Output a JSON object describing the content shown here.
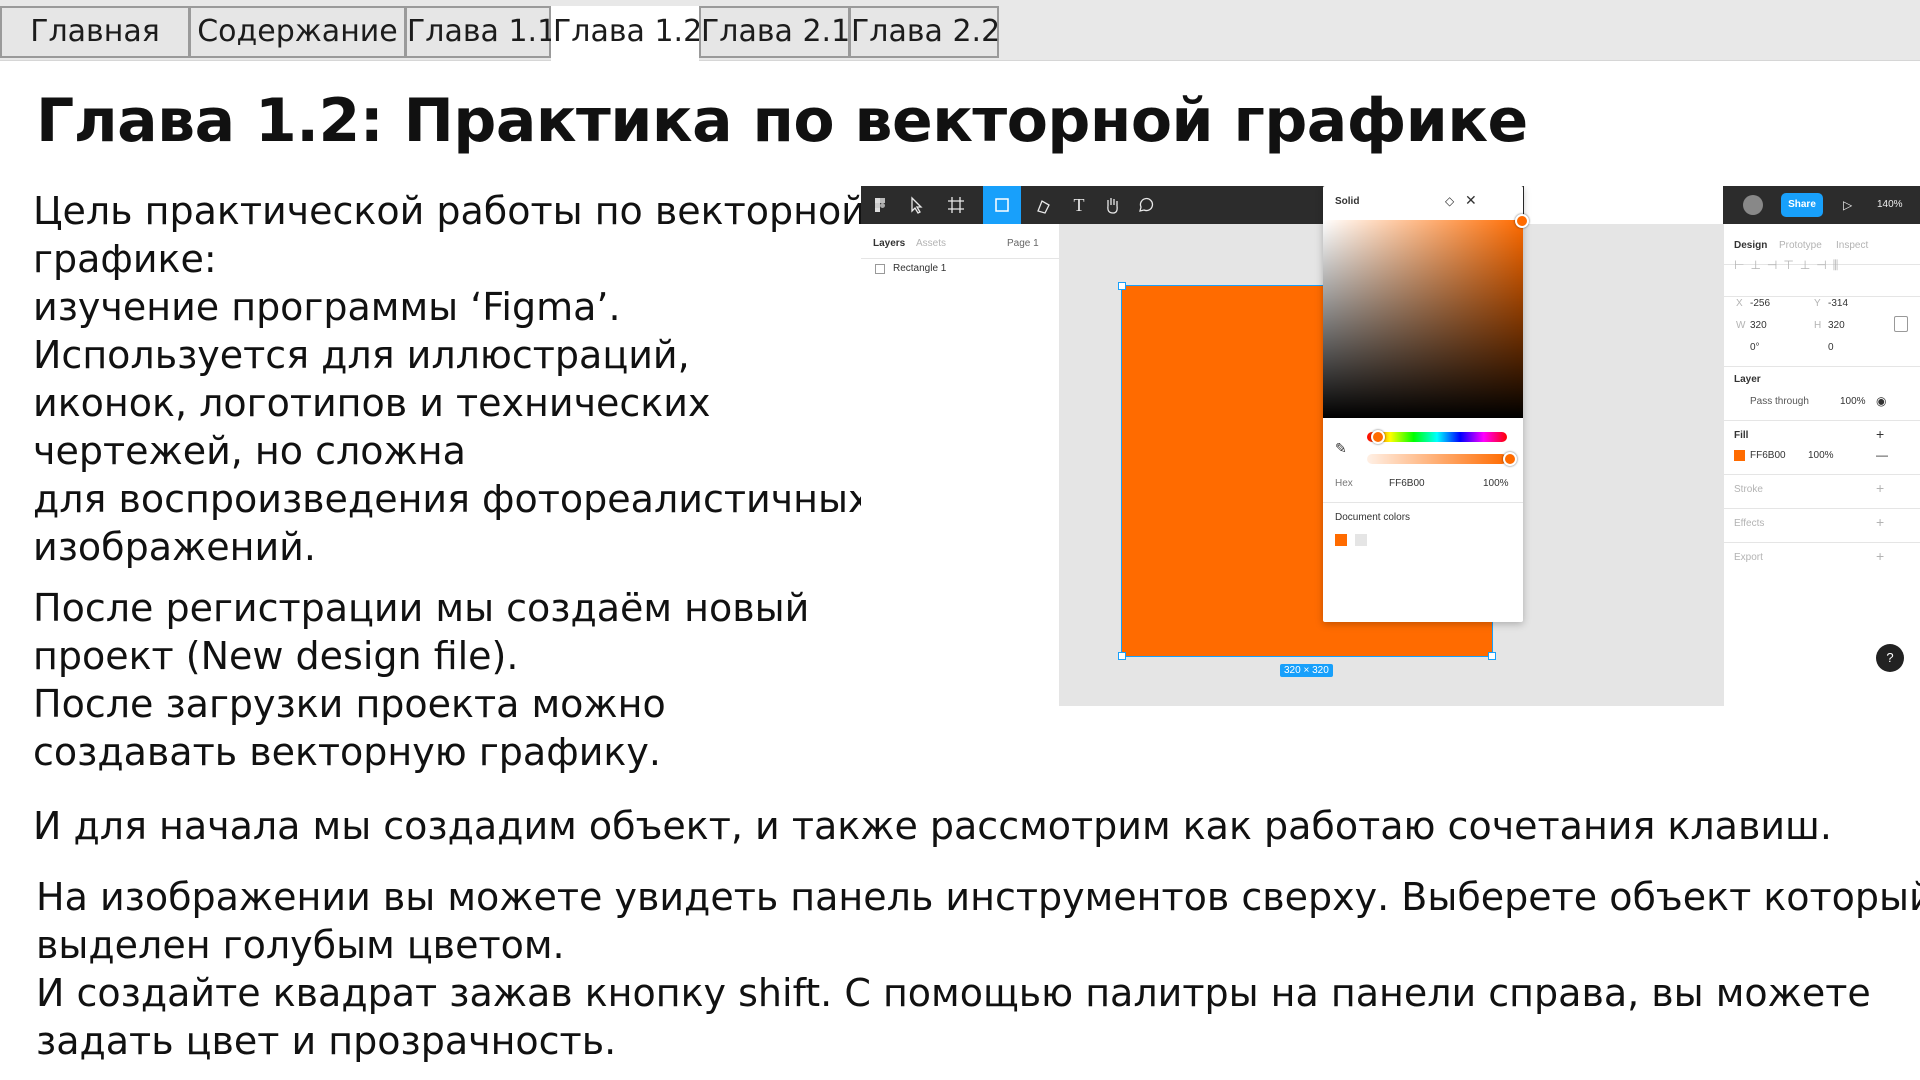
{
  "tabs": [
    {
      "label": "Главная"
    },
    {
      "label": "Содержание"
    },
    {
      "label": "Глава 1.1"
    },
    {
      "label": "Глава 1.2"
    },
    {
      "label": "Глава 2.1"
    },
    {
      "label": "Глава 2.2"
    }
  ],
  "title": "Глава 1.2: Практика по векторной графике",
  "intro_lines": [
    "Цель практической работы по векторной",
    "графике:",
    "изучение программы ‘Figma’.",
    "Используется для иллюстраций,",
    "иконок, логотипов и технических",
    "чертежей, но сложна",
    "для воспроизведения фотореалистичных",
    "изображений."
  ],
  "register_lines": [
    "После регистрации мы создаём новый",
    "проект (New design file).",
    "После загрузки проекта можно",
    "создавать векторную графику."
  ],
  "shortcut_line": "И для начала мы создадим объект, и также рассмотрим как работаю сочетания клавиш.",
  "toolbar_lines": [
    "На изображении вы можете увидеть панель инструментов сверху. Выберете объект который",
    "выделен голубым цветом.",
    "И создайте квадрат зажав кнопку shift. С помощью палитры на панели справа, вы можете",
    "задать цвет и прозрачность."
  ],
  "figma": {
    "accent": "#18a0fb",
    "fill_color": "#FF6B00",
    "layers_tab": "Layers",
    "assets_tab": "Assets",
    "page_label": "Page 1",
    "layer_name": "Rectangle 1",
    "dimension_label": "320 × 320",
    "picker": {
      "mode": "Solid",
      "hex_label": "Hex",
      "hex_value": "FF6B00",
      "opacity": "100%",
      "doc_colors": "Document colors"
    },
    "share_label": "Share",
    "zoom": "140%",
    "design_tab": "Design",
    "prototype_tab": "Prototype",
    "inspect_tab": "Inspect",
    "x_label": "X",
    "x_value": "-256",
    "y_label": "Y",
    "y_value": "-314",
    "w_label": "W",
    "w_value": "320",
    "h_label": "H",
    "h_value": "320",
    "rotation": "0°",
    "radius": "0",
    "layer_section": "Layer",
    "blend_mode": "Pass through",
    "layer_opacity": "100%",
    "fill_section": "Fill",
    "fill_hex": "FF6B00",
    "fill_opacity": "100%",
    "stroke_section": "Stroke",
    "effects_section": "Effects",
    "export_section": "Export",
    "help": "?"
  }
}
